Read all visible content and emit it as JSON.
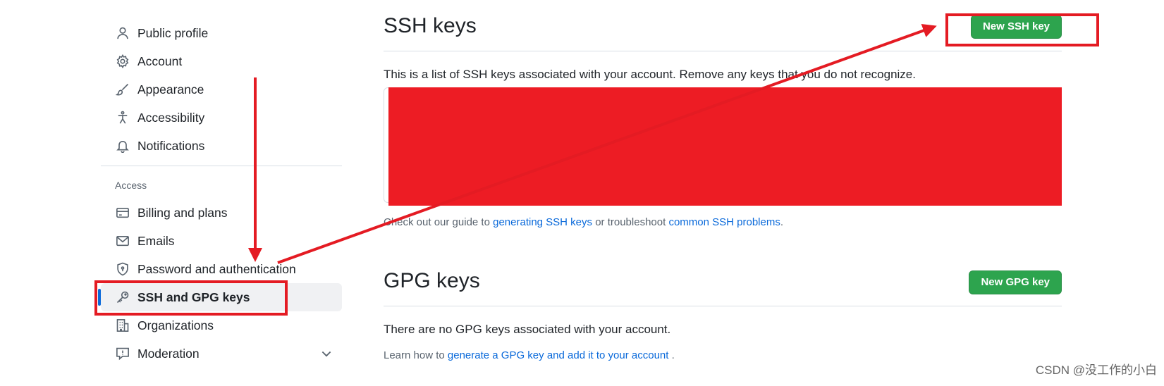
{
  "sidebar": {
    "items_top": [
      {
        "label": "Public profile",
        "icon": "person-icon"
      },
      {
        "label": "Account",
        "icon": "gear-icon"
      },
      {
        "label": "Appearance",
        "icon": "paintbrush-icon"
      },
      {
        "label": "Accessibility",
        "icon": "accessibility-icon"
      },
      {
        "label": "Notifications",
        "icon": "bell-icon"
      }
    ],
    "access_heading": "Access",
    "items_access": [
      {
        "label": "Billing and plans",
        "icon": "credit-card-icon"
      },
      {
        "label": "Emails",
        "icon": "mail-icon"
      },
      {
        "label": "Password and authentication",
        "icon": "shield-lock-icon"
      },
      {
        "label": "SSH and GPG keys",
        "icon": "key-icon",
        "selected": true
      },
      {
        "label": "Organizations",
        "icon": "organization-icon"
      },
      {
        "label": "Moderation",
        "icon": "report-icon",
        "expandable": true
      }
    ]
  },
  "ssh": {
    "title": "SSH keys",
    "new_button": "New SSH key",
    "description": "This is a list of SSH keys associated with your account. Remove any keys that you do not recognize.",
    "guide_prefix": "Check out our guide to",
    "guide_link": "generating SSH keys",
    "guide_middle": "or troubleshoot",
    "problems_link": "common SSH problems",
    "guide_suffix": "."
  },
  "gpg": {
    "title": "GPG keys",
    "new_button": "New GPG key",
    "empty_text": "There are no GPG keys associated with your account.",
    "learn_prefix": "Learn how to",
    "learn_link": "generate a GPG key and add it to your account",
    "learn_suffix": "."
  },
  "watermark": "CSDN @没工作的小白",
  "colors": {
    "accent": "#0969da",
    "button_green": "#2da44e",
    "annotation_red": "#e41b23",
    "redaction_red": "#ed1c24"
  }
}
